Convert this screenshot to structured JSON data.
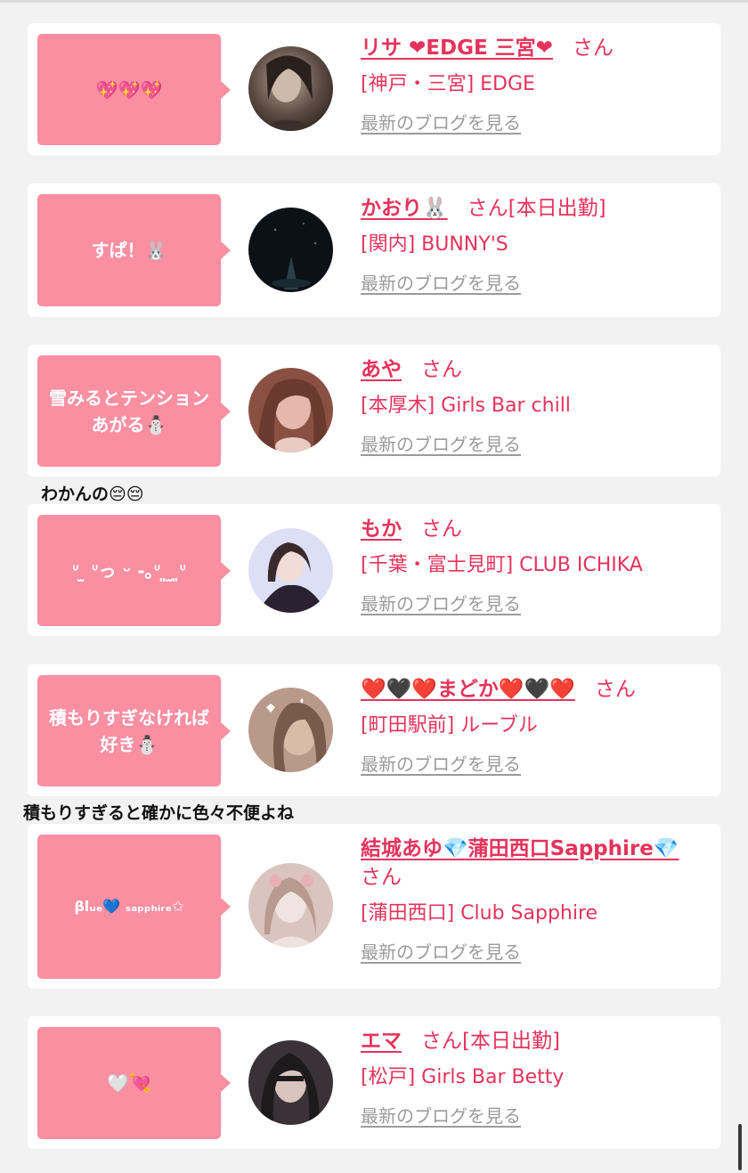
{
  "entries": [
    {
      "bubble": "💖💖💖",
      "name": "リサ ❤EDGE 三宮❤",
      "honorific": "さん",
      "status": "",
      "shop": "[神戸・三宮] EDGE",
      "blog_link": "最新のブログを見る",
      "avatar_colors": [
        "#2b211d",
        "#b9a395"
      ]
    },
    {
      "bubble": "すぱ！🐰",
      "name": "かおり🐰",
      "honorific": "さん",
      "status": "[本日出勤]",
      "shop": "[関内] BUNNY'S",
      "blog_link": "最新のブログを見る",
      "avatar_colors": [
        "#0c1116",
        "#2b3f4a"
      ]
    },
    {
      "bubble": "雪みるとテンションあがる⛄",
      "name": "あや",
      "honorific": "さん",
      "status": "",
      "shop": "[本厚木] Girls Bar chill",
      "blog_link": "最新のブログを見る",
      "avatar_colors": [
        "#6b3a2e",
        "#e6b8ad"
      ]
    },
    {
      "bubble": "ᐡ ̫ ᐡっ ᵕ -｡ᐡ ͈ ̫ ͈ᐡ",
      "name": "もか",
      "honorific": "さん",
      "status": "",
      "shop": "[千葉・富士見町] CLUB ICHIKA",
      "blog_link": "最新のブログを見る",
      "avatar_colors": [
        "#dcdff5",
        "#2a2230"
      ]
    },
    {
      "bubble": "積もりすぎなければ好き⛄",
      "name": "❤️🖤❤️まどか❤️🖤❤️",
      "honorific": "さん",
      "status": "",
      "shop": "[町田駅前] ルーブル",
      "blog_link": "最新のブログを見る",
      "avatar_colors": [
        "#7a5a4a",
        "#d8bca8"
      ]
    },
    {
      "bubble": "βlᵤₑ💙 ₛₐₚₚₕᵢᵣₑ✩",
      "name": "結城あゆ💎蒲田西口Sapphire💎",
      "honorific": "さん",
      "status": "",
      "shop": "[蒲田西口] Club Sapphire",
      "blog_link": "最新のブログを見る",
      "avatar_colors": [
        "#b89a90",
        "#f0e4e0"
      ]
    },
    {
      "bubble": "🤍💘",
      "name": "エマ",
      "honorific": "さん",
      "status": "[本日出勤]",
      "shop": "[松戸] Girls Bar Betty",
      "blog_link": "最新のブログを見る",
      "avatar_colors": [
        "#1d1a1c",
        "#d9c3bd"
      ]
    }
  ],
  "captions": {
    "after_aya": "わかんの😔😔",
    "after_madoka": "積もりすぎると確かに色々不便よね"
  }
}
